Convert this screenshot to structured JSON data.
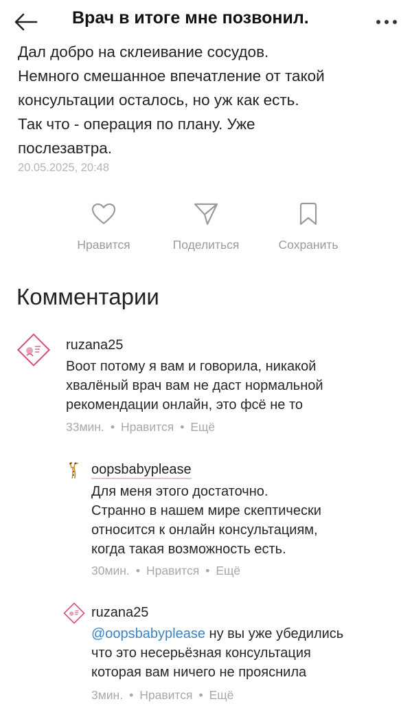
{
  "header": {
    "title": "Врач в итоге мне позвонил.",
    "back_icon": "arrow-left-icon",
    "more_icon": "more-dots-icon"
  },
  "post": {
    "lines": [
      "Дал добро на склеивание сосудов.",
      "Немного смешанное впечатление от такой",
      "консультации осталось, но уж как есть.",
      "Так что - операция по плану. Уже",
      "послезавтра."
    ],
    "date": "20.05.2025, 20:48"
  },
  "actions": {
    "like_label": "Нравится",
    "share_label": "Поделиться",
    "save_label": "Сохранить"
  },
  "comments_title": "Комментарии",
  "comments": [
    {
      "user": "ruzana25",
      "lines": [
        "Воот потому я вам и говорила, никакой",
        "хвалёный врач вам не даст нормальной",
        "рекомендации онлайн, это фсё не то"
      ],
      "time": "33мин.",
      "like": "Нравится",
      "more": "Ещё"
    },
    {
      "user": "oopsbabyplease",
      "lines": [
        "Для меня этого достаточно.",
        "Странно в нашем мире скептически",
        "относится к онлайн консультациям,",
        "когда такая возможность есть."
      ],
      "time": "30мин.",
      "like": "Нравится",
      "more": "Ещё"
    },
    {
      "user": "ruzana25",
      "mention": "@oopsbabyplease",
      "first_line_rest": " ну вы уже убедились",
      "lines": [
        "что это несерьёзная консультация",
        "которая вам ничего не прояснила"
      ],
      "time": "3мин.",
      "like": "Нравится",
      "more": "Ещё"
    }
  ],
  "colors": {
    "mention": "#3b82c4",
    "muted": "#a8a8a8",
    "avatar_pink": "#d94a7a"
  }
}
